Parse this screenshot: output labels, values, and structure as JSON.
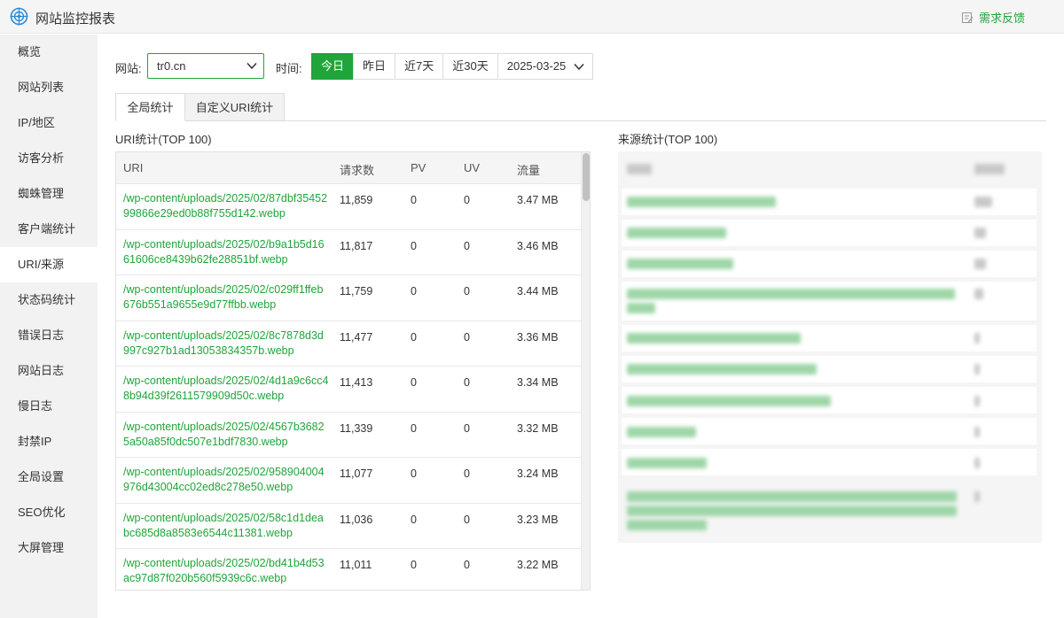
{
  "app": {
    "title": "网站监控报表",
    "feedback_label": "需求反馈"
  },
  "sidebar": {
    "items": [
      {
        "label": "概览"
      },
      {
        "label": "网站列表"
      },
      {
        "label": "IP/地区"
      },
      {
        "label": "访客分析"
      },
      {
        "label": "蜘蛛管理"
      },
      {
        "label": "客户端统计"
      },
      {
        "label": "URI/来源",
        "active": true
      },
      {
        "label": "状态码统计"
      },
      {
        "label": "错误日志"
      },
      {
        "label": "网站日志"
      },
      {
        "label": "慢日志"
      },
      {
        "label": "封禁IP"
      },
      {
        "label": "全局设置"
      },
      {
        "label": "SEO优化"
      },
      {
        "label": "大屏管理"
      }
    ]
  },
  "filters": {
    "site_label": "网站:",
    "site_value": "tr0.cn",
    "time_label": "时间:",
    "ranges": [
      "今日",
      "昨日",
      "近7天",
      "近30天"
    ],
    "active_range": "今日",
    "date_value": "2025-03-25"
  },
  "tabs": [
    "全局统计",
    "自定义URI统计"
  ],
  "uri_section": {
    "title": "URI统计(TOP 100)",
    "columns": [
      "URI",
      "请求数",
      "PV",
      "UV",
      "流量"
    ],
    "rows": [
      {
        "uri": "/wp-content/uploads/2025/02/87dbf3545299866e29ed0b88f755d142.webp",
        "requests": "11,859",
        "pv": "0",
        "uv": "0",
        "traffic": "3.47 MB"
      },
      {
        "uri": "/wp-content/uploads/2025/02/b9a1b5d1661606ce8439b62fe28851bf.webp",
        "requests": "11,817",
        "pv": "0",
        "uv": "0",
        "traffic": "3.46 MB"
      },
      {
        "uri": "/wp-content/uploads/2025/02/c029ff1ffeb676b551a9655e9d77ffbb.webp",
        "requests": "11,759",
        "pv": "0",
        "uv": "0",
        "traffic": "3.44 MB"
      },
      {
        "uri": "/wp-content/uploads/2025/02/8c7878d3d997c927b1ad13053834357b.webp",
        "requests": "11,477",
        "pv": "0",
        "uv": "0",
        "traffic": "3.36 MB"
      },
      {
        "uri": "/wp-content/uploads/2025/02/4d1a9c6cc48b94d39f2611579909d50c.webp",
        "requests": "11,413",
        "pv": "0",
        "uv": "0",
        "traffic": "3.34 MB"
      },
      {
        "uri": "/wp-content/uploads/2025/02/4567b36825a50a85f0dc507e1bdf7830.webp",
        "requests": "11,339",
        "pv": "0",
        "uv": "0",
        "traffic": "3.32 MB"
      },
      {
        "uri": "/wp-content/uploads/2025/02/958904004976d43004cc02ed8c278e50.webp",
        "requests": "11,077",
        "pv": "0",
        "uv": "0",
        "traffic": "3.24 MB"
      },
      {
        "uri": "/wp-content/uploads/2025/02/58c1d1deabc685d8a8583e6544c11381.webp",
        "requests": "11,036",
        "pv": "0",
        "uv": "0",
        "traffic": "3.23 MB"
      },
      {
        "uri": "/wp-content/uploads/2025/02/bd41b4d53ac97d87f020b560f5939c6c.webp",
        "requests": "11,011",
        "pv": "0",
        "uv": "0",
        "traffic": "3.22 MB"
      }
    ]
  },
  "source_section": {
    "title": "来源统计(TOP 100)"
  },
  "colors": {
    "accent": "#20a53a",
    "sidebar_bg": "#f2f2f2"
  }
}
